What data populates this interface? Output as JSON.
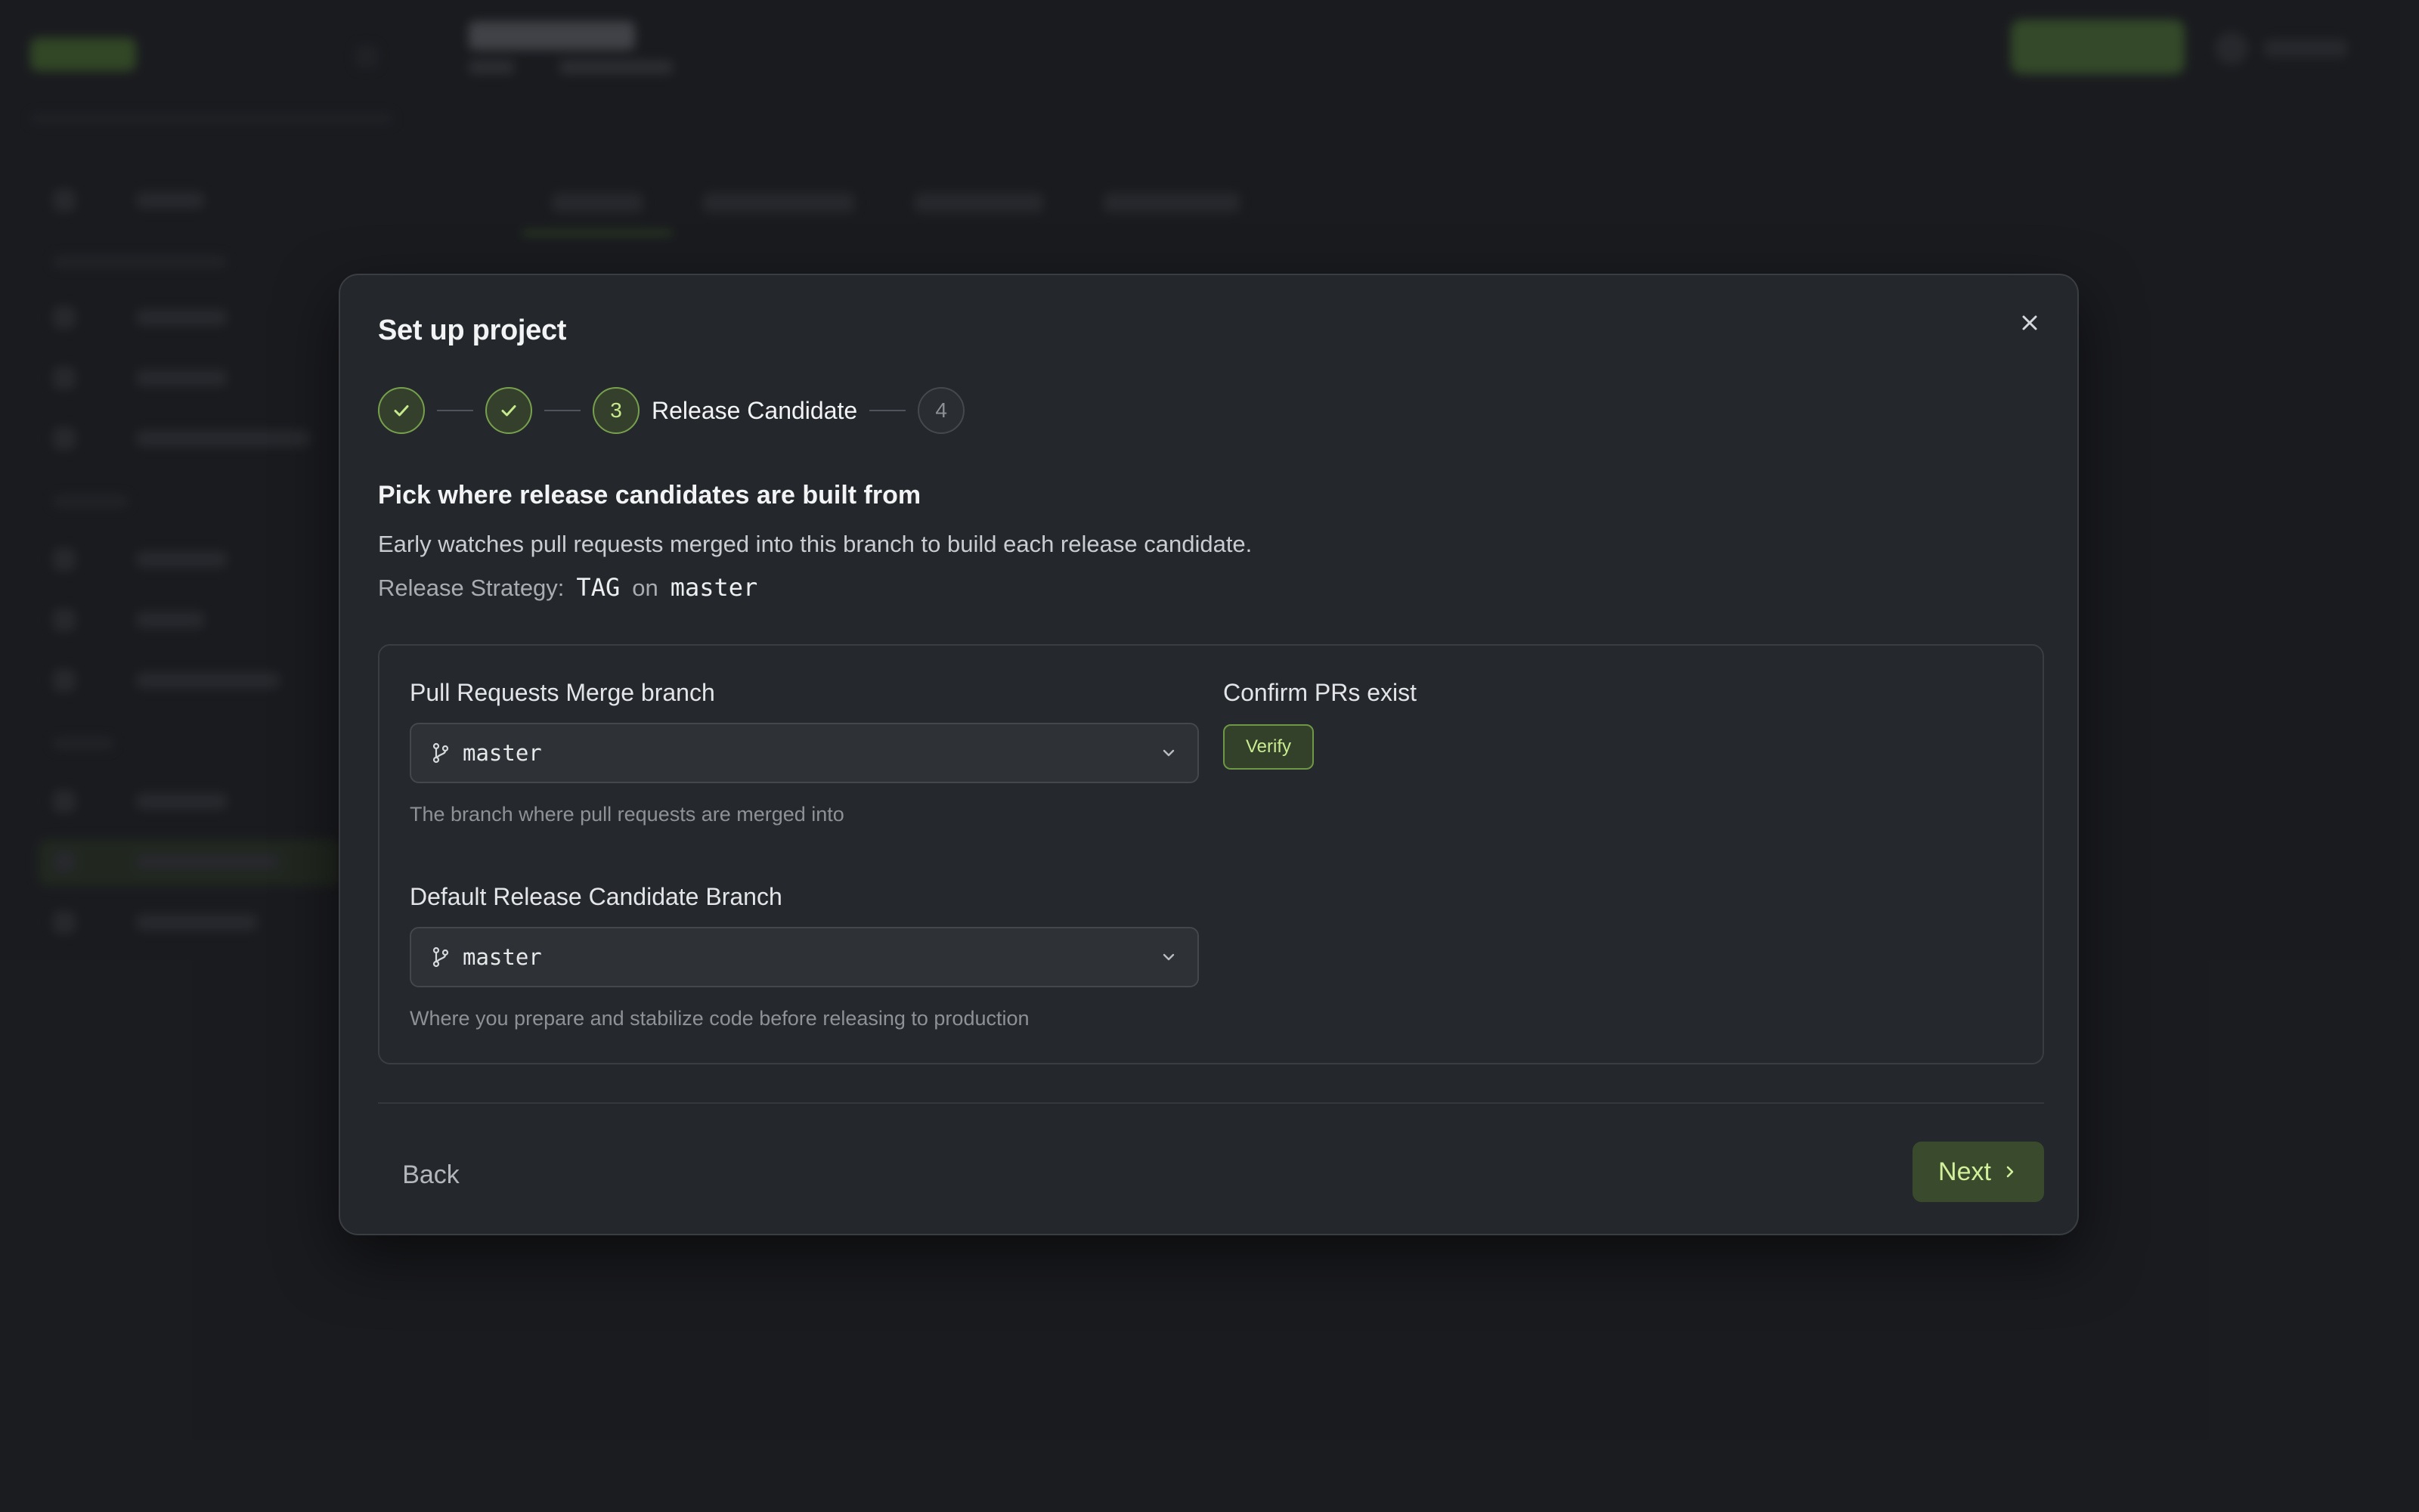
{
  "modal": {
    "title": "Set up project",
    "close_icon": "close-icon",
    "stepper": {
      "steps": [
        {
          "state": "done",
          "icon": "check-icon"
        },
        {
          "state": "done",
          "icon": "check-icon"
        },
        {
          "state": "active",
          "number": "3",
          "label": "Release Candidate"
        },
        {
          "state": "todo",
          "number": "4"
        }
      ]
    },
    "heading": "Pick where release candidates are built from",
    "description": "Early watches pull requests merged into this branch to build each release candidate.",
    "strategy": {
      "label": "Release Strategy:",
      "type": "TAG",
      "joiner": "on",
      "branch": "master"
    },
    "card": {
      "merge_branch": {
        "label": "Pull Requests Merge branch",
        "value": "master",
        "help": "The branch where pull requests are merged into",
        "icon": "git-branch-icon"
      },
      "confirm": {
        "label": "Confirm PRs exist",
        "button": "Verify"
      },
      "rc_branch": {
        "label": "Default Release Candidate Branch",
        "value": "master",
        "help": "Where you prepare and stabilize code before releasing to production",
        "icon": "git-branch-icon"
      }
    },
    "footer": {
      "back": "Back",
      "next": "Next"
    }
  },
  "colors": {
    "accent": "#77a04d",
    "accent_text": "#c6e98c",
    "modal_bg": "#24272b",
    "page_bg": "#1f2125"
  }
}
